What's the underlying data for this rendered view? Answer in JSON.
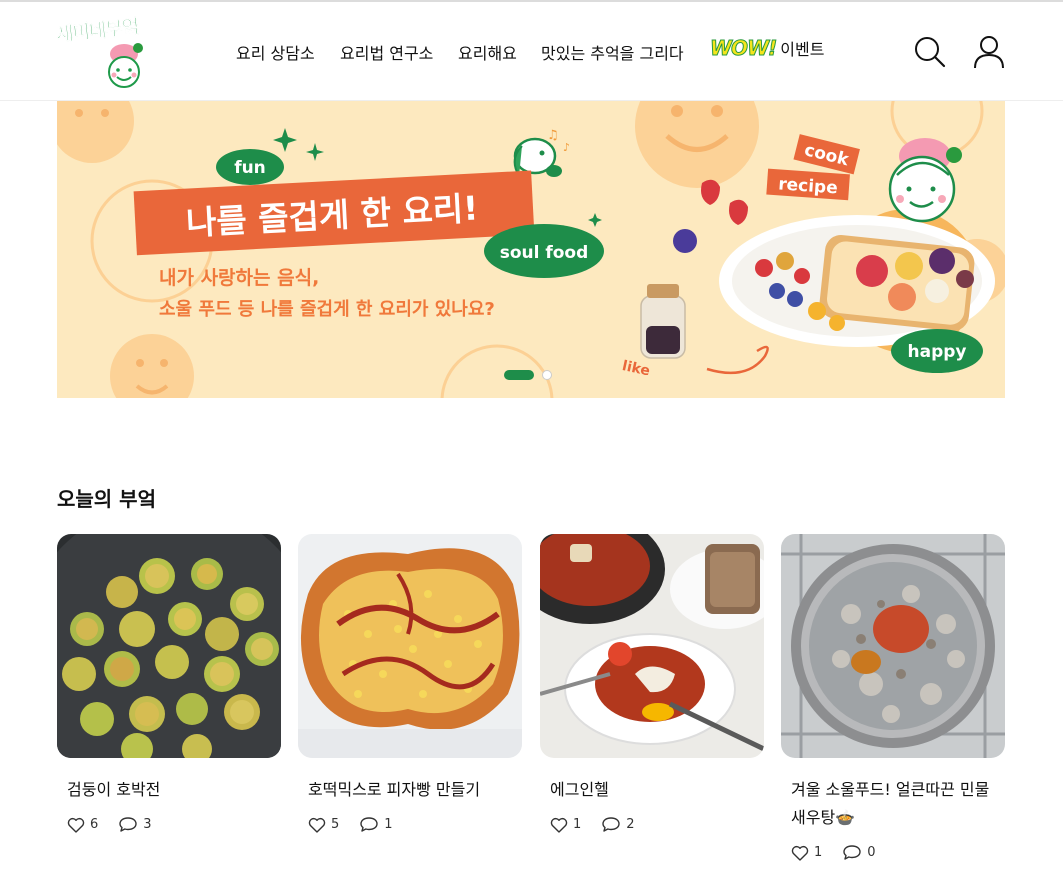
{
  "brand": {
    "logo_text": "새미네부엌"
  },
  "nav": {
    "items": [
      "요리 상담소",
      "요리법 연구소",
      "요리해요",
      "맛있는 추억을 그리다"
    ],
    "event_badge": "WOW!",
    "event_label": "이벤트"
  },
  "banner": {
    "headline": "나를 즐겁게 한 요리!",
    "subline1": "내가 사랑하는 음식,",
    "subline2": "소울 푸드 등 나를 즐겁게 한 요리가 있나요?",
    "tags": {
      "fun": "fun",
      "soul_food": "soul food",
      "cook": "cook",
      "recipe": "recipe",
      "happy": "happy",
      "like": "like"
    },
    "slide_count": 2,
    "active_slide": 1
  },
  "section": {
    "title": "오늘의 부엌"
  },
  "cards": [
    {
      "title": "검둥이 호박전",
      "likes": "6",
      "comments": "3"
    },
    {
      "title": "호떡믹스로 피자빵 만들기",
      "likes": "5",
      "comments": "1"
    },
    {
      "title": "에그인헬",
      "likes": "1",
      "comments": "2"
    },
    {
      "title": "겨울 소울푸드! 얼큰따끈 민물새우탕🍲",
      "likes": "1",
      "comments": "0"
    }
  ],
  "colors": {
    "brand_green": "#1e8d4a",
    "banner_bg": "#fde9bf",
    "banner_orange": "#e9673a"
  }
}
